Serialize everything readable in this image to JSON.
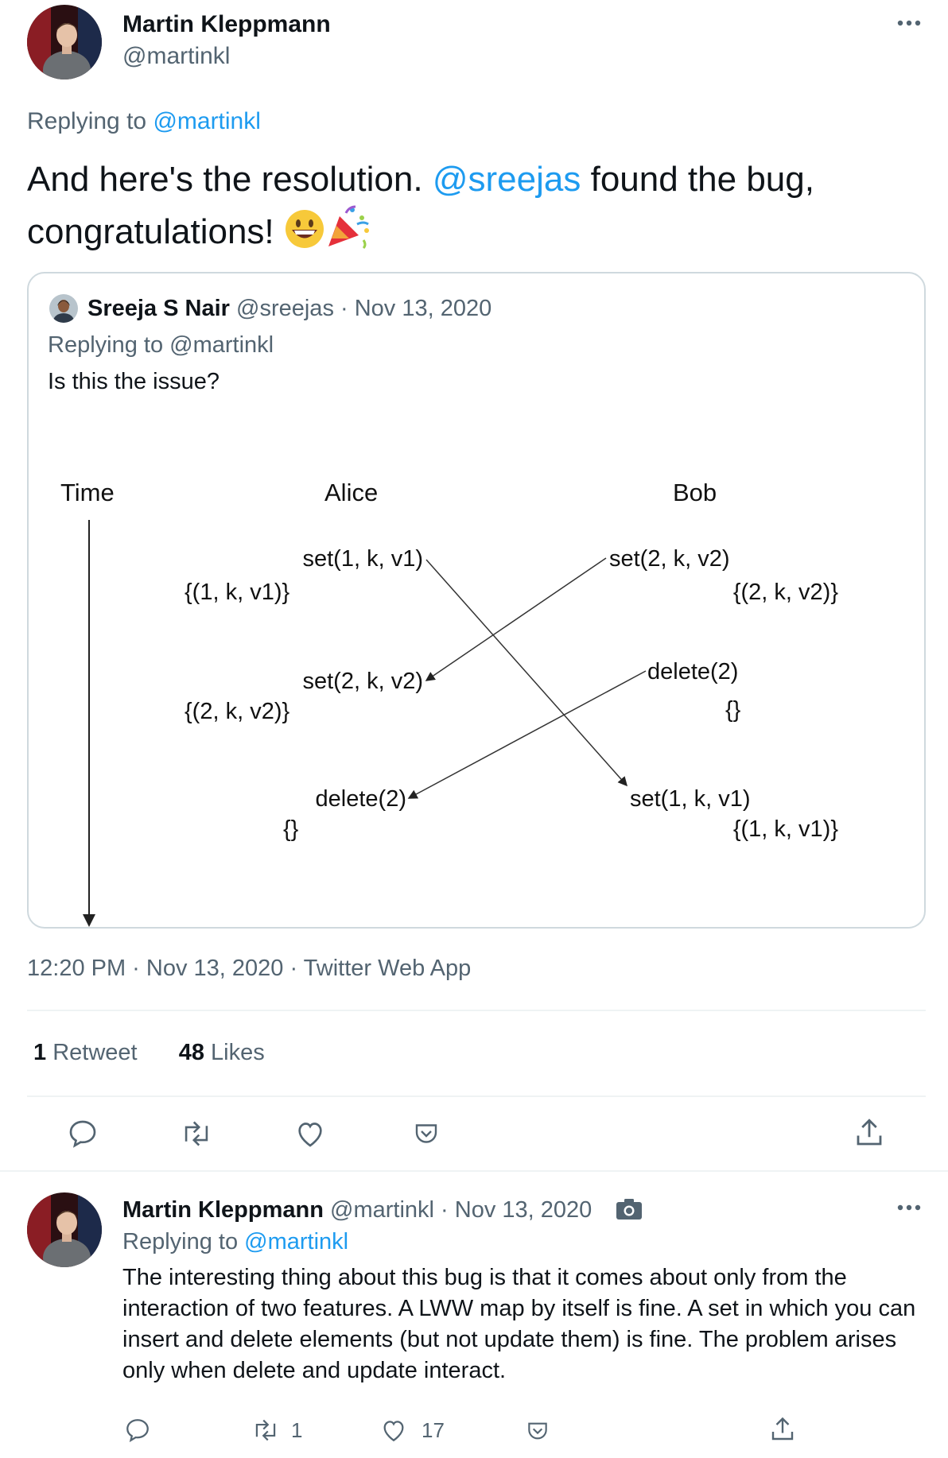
{
  "main_tweet": {
    "author_name": "Martin Kleppmann",
    "author_handle": "@martinkl",
    "replying_prefix": "Replying to",
    "replying_to": "@martinkl",
    "text_part1": "And here's the resolution.",
    "text_mention": "@sreejas",
    "text_part2": "found the bug,",
    "text_line2": "congratulations!",
    "emojis": [
      "grinning-face",
      "party-popper"
    ],
    "timestamp": "12:20 PM · Nov 13, 2020 · Twitter Web App",
    "retweets_count": "1",
    "retweets_label": "Retweet",
    "likes_count": "48",
    "likes_label": "Likes"
  },
  "quoted_tweet": {
    "author_name": "Sreeja S Nair",
    "author_handle": "@sreejas",
    "date": "· Nov 13, 2020",
    "replying_prefix": "Replying to",
    "replying_to": "@martinkl",
    "text": "Is this the issue?",
    "diagram": {
      "time_label": "Time",
      "alice_label": "Alice",
      "bob_label": "Bob",
      "alice_ops": [
        {
          "op": "set(1, k, v1)",
          "state": "{(1, k, v1)}"
        },
        {
          "op": "set(2, k, v2)",
          "state": "{(2, k, v2)}"
        },
        {
          "op": "delete(2)",
          "state": "{}"
        }
      ],
      "bob_ops": [
        {
          "op": "set(2, k, v2)",
          "state": "{(2, k, v2)}"
        },
        {
          "op": "delete(2)",
          "state": "{}"
        },
        {
          "op": "set(1, k, v1)",
          "state": "{(1, k, v1)}"
        }
      ]
    }
  },
  "reply_tweet": {
    "author_name": "Martin Kleppmann",
    "author_handle": "@martinkl",
    "date": "· Nov 13, 2020",
    "replying_prefix": "Replying to",
    "replying_to": "@martinkl",
    "text": "The interesting thing about this bug is that it comes about only from the interaction of two features. A LWW map by itself is fine. A set in which you can insert and delete elements (but not update them) is fine. The problem arises only when delete and update interact.",
    "retweet_count": "1",
    "like_count": "17"
  },
  "colors": {
    "accent": "#1d9bf0",
    "muted": "#536471",
    "border": "#cfd9de"
  }
}
